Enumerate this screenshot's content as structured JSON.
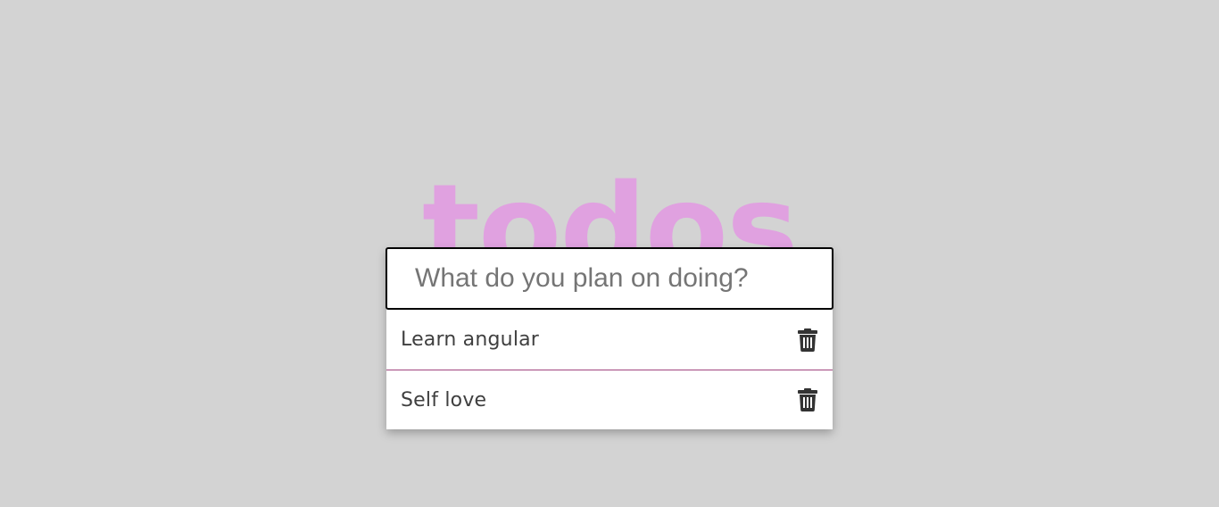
{
  "app": {
    "title": "todos",
    "accent_color": "#e0a1e0",
    "background_color": "#d3d3d3"
  },
  "input": {
    "placeholder": "What do you plan on doing?",
    "value": ""
  },
  "todos": [
    {
      "text": "Learn angular",
      "delete_icon": "trash-icon"
    },
    {
      "text": "Self love",
      "delete_icon": "trash-icon"
    }
  ]
}
